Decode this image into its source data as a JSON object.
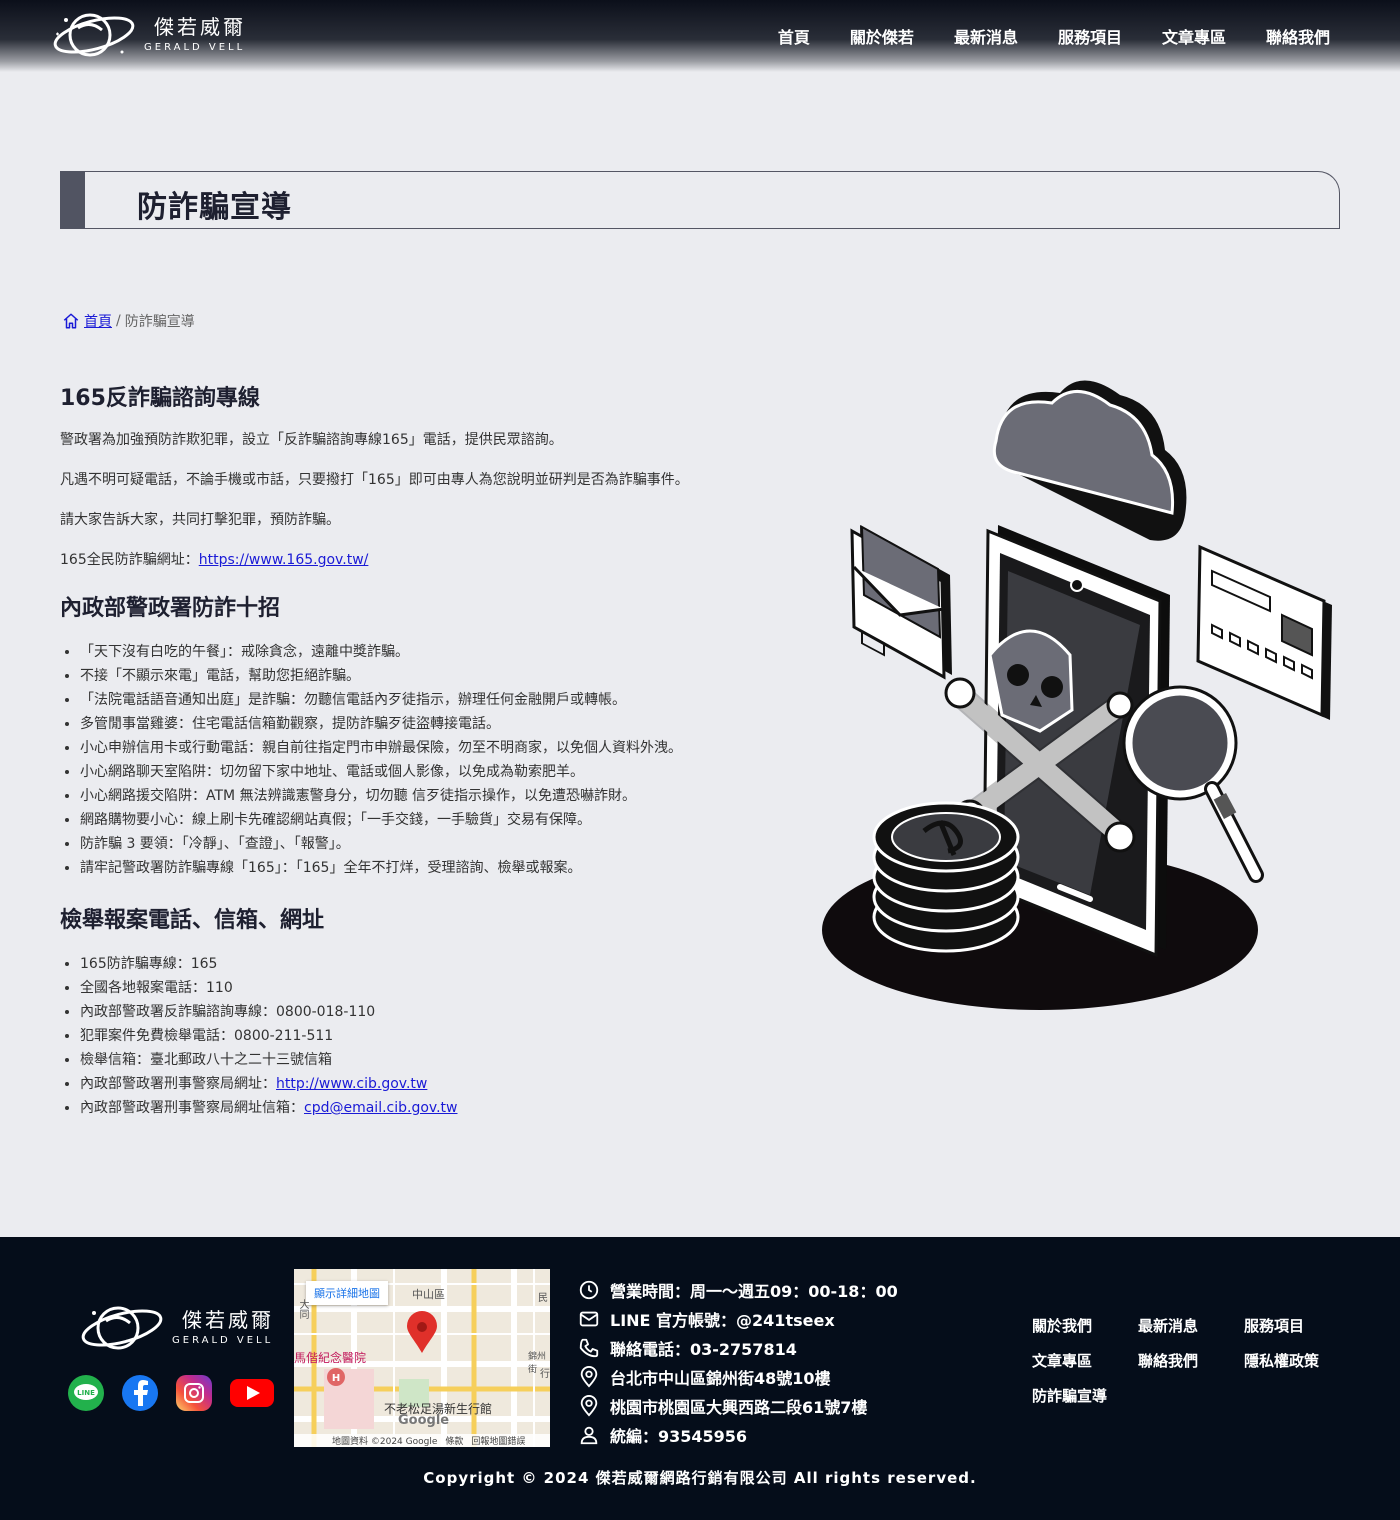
{
  "header": {
    "logo_cn": "傑若威爾",
    "logo_en": "GERALD VELL",
    "nav": [
      "首頁",
      "關於傑若",
      "最新消息",
      "服務項目",
      "文章專區",
      "聯絡我們"
    ]
  },
  "page_title": "防詐騙宣導",
  "breadcrumb": {
    "home": "首頁",
    "separator": "/",
    "current": "防詐騙宣導"
  },
  "section1": {
    "heading": "165反詐騙諮詢專線",
    "p1": "警政署為加強預防詐欺犯罪，設立「反詐騙諮詢專線165」電話，提供民眾諮詢。",
    "p2": "凡遇不明可疑電話，不論手機或市話，只要撥打「165」即可由專人為您說明並研判是否為詐騙事件。",
    "p3": "請大家告訴大家，共同打擊犯罪，預防詐騙。",
    "p4_label": "165全民防詐騙網址：",
    "p4_link": "https://www.165.gov.tw/"
  },
  "section2": {
    "heading": "內政部警政署防詐十招",
    "items": [
      "「天下沒有白吃的午餐」：戒除貪念，遠離中獎詐騙。",
      "不接「不顯示來電」電話，幫助您拒絕詐騙。",
      "「法院電話語音通知出庭」是詐騙：勿聽信電話內歹徒指示，辦理任何金融開戶或轉帳。",
      "多管閒事當雞婆：住宅電話信箱勤觀察，提防詐騙歹徒盜轉接電話。",
      "小心申辦信用卡或行動電話：親自前往指定門市申辦最保險，勿至不明商家，以免個人資料外洩。",
      "小心網路聊天室陷阱：切勿留下家中地址、電話或個人影像，以免成為勒索肥羊。",
      "小心網路援交陷阱：ATM 無法辨識憲警身分，切勿聽 信歹徒指示操作，以免遭恐嚇詐財。",
      "網路購物要小心：線上刷卡先確認網站真假；「一手交錢，一手驗貨」交易有保障。",
      "防詐騙 3 要領：「冷靜」、「查證」、「報警」。",
      "請牢記警政署防詐騙專線「165」：「165」全年不打烊，受理諮詢、檢舉或報案。"
    ]
  },
  "section3": {
    "heading": "檢舉報案電話、信箱、網址",
    "items": [
      "165防詐騙專線：165",
      "全國各地報案電話：110",
      "內政部警政署反詐騙諮詢專線：0800-018-110",
      "犯罪案件免費檢舉電話：0800-211-511",
      "檢舉信箱：臺北郵政八十之二十三號信箱"
    ],
    "cib_label": "內政部警政署刑事警察局網址：",
    "cib_link": "http://www.cib.gov.tw",
    "email_label": "內政部警政署刑事警察局網址信箱：",
    "email_link": "cpd@email.cib.gov.tw"
  },
  "footer": {
    "logo_cn": "傑若威爾",
    "logo_en": "GERALD VELL",
    "social": [
      "line-icon",
      "facebook-icon",
      "instagram-icon",
      "youtube-icon"
    ],
    "map": {
      "button": "顯示詳細地圖",
      "labels": [
        "中山區",
        "馬偕紀念醫院",
        "不老松足湯新生行館",
        "錦州街",
        "民",
        "行",
        "大同"
      ],
      "attribution": "地圖資料 ©2024 Google",
      "terms": "條款",
      "report": "回報地圖錯誤",
      "brand": "Google"
    },
    "info": [
      "營業時間：周一～週五09：00-18：00",
      "LINE 官方帳號：@241tseex",
      "聯絡電話：03-2757814",
      "台北市中山區錦州街48號10樓",
      "桃園市桃園區大興西路二段61號7樓",
      "統編：93545956"
    ],
    "links": [
      "關於我們",
      "最新消息",
      "服務項目",
      "文章專區",
      "聯絡我們",
      "隱私權政策",
      "防詐騙宣導"
    ],
    "copyright": "Copyright © 2024 傑若威爾網路行銷有限公司 All rights reserved."
  }
}
